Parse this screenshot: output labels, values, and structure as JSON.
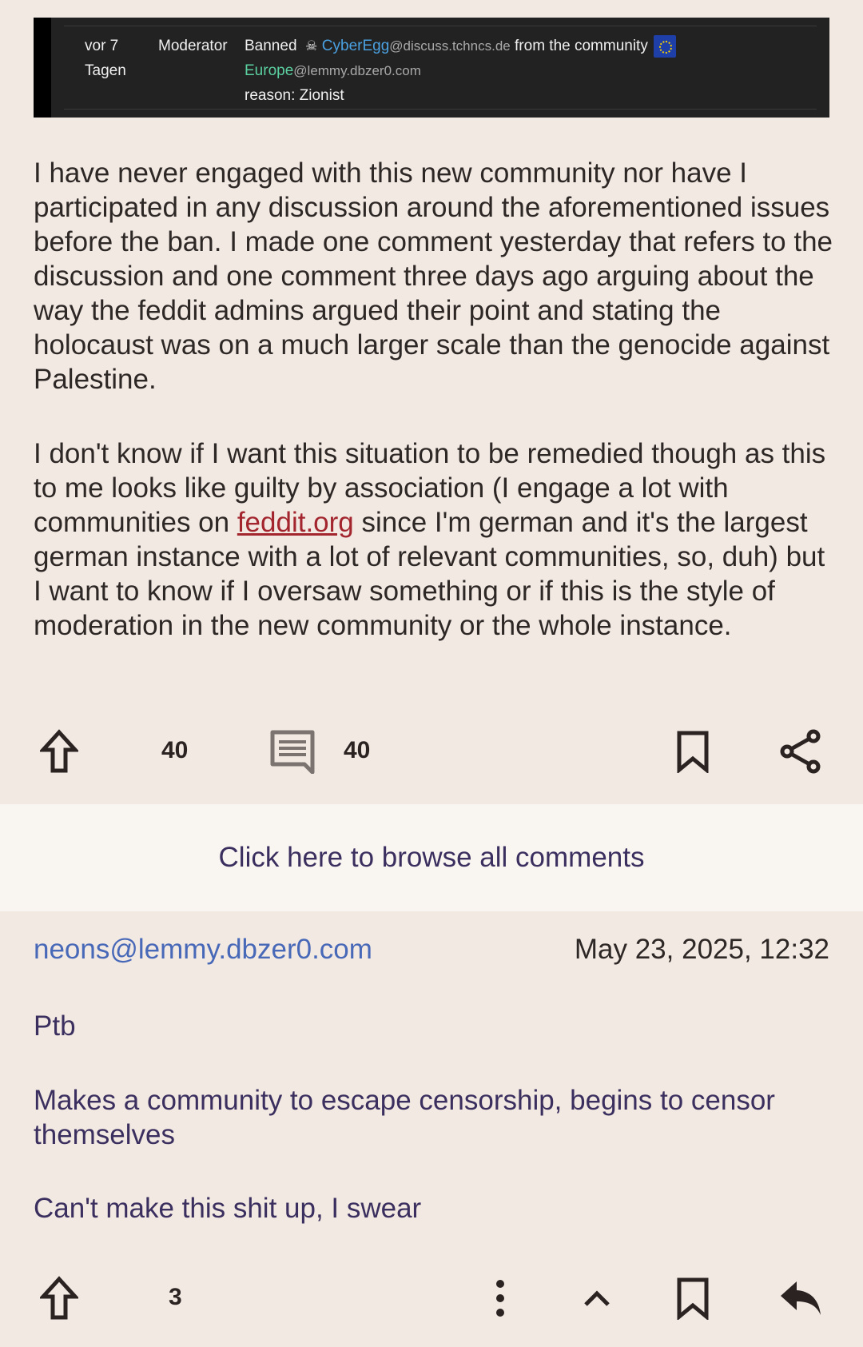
{
  "modlog": {
    "time": "vor 7 Tagen",
    "role": "Moderator",
    "action": "Banned",
    "user": "CyberEgg",
    "user_instance": "@discuss.tchncs.de",
    "from_text": "from the community",
    "community": "Europe",
    "community_instance": "@lemmy.dbzer0.com",
    "reason": "reason: Zionist"
  },
  "post": {
    "paragraph1": "I have never engaged with this new community nor have I participated in any discussion around the aforementioned issues before the ban. I made one comment yesterday that refers to the discussion and one comment three days ago arguing about the way the feddit admins argued their point and stating the holocaust was on a much larger scale than the genocide against Palestine.",
    "paragraph2_before_link": "I don't know if I want this situation to be remedied though as this to me looks like guilty by association (I engage a lot with communities on ",
    "paragraph2_link": "feddit.org",
    "paragraph2_after_link": " since I'm german and it's the largest german instance with a lot of relevant communities, so, duh) but I want to know if I oversaw something or if this is the style of moderation in the new community or the whole instance.",
    "upvotes": "40",
    "comments": "40"
  },
  "browse_all_label": "Click here to browse all comments",
  "comment": {
    "author": "neons@lemmy.dbzer0.com",
    "date": "May 23, 2025, 12:32",
    "line1": "Ptb",
    "line2": "Makes a community to escape censorship, begins to censor themselves",
    "line3": "Can't make this shit up, I swear",
    "upvotes": "3"
  },
  "icons": {
    "upvote": "upvote-arrow-icon",
    "comment": "comment-bubble-icon",
    "bookmark": "bookmark-icon",
    "share": "share-icon",
    "more": "more-vertical-icon",
    "collapse": "chevron-up-icon",
    "reply": "reply-icon"
  }
}
